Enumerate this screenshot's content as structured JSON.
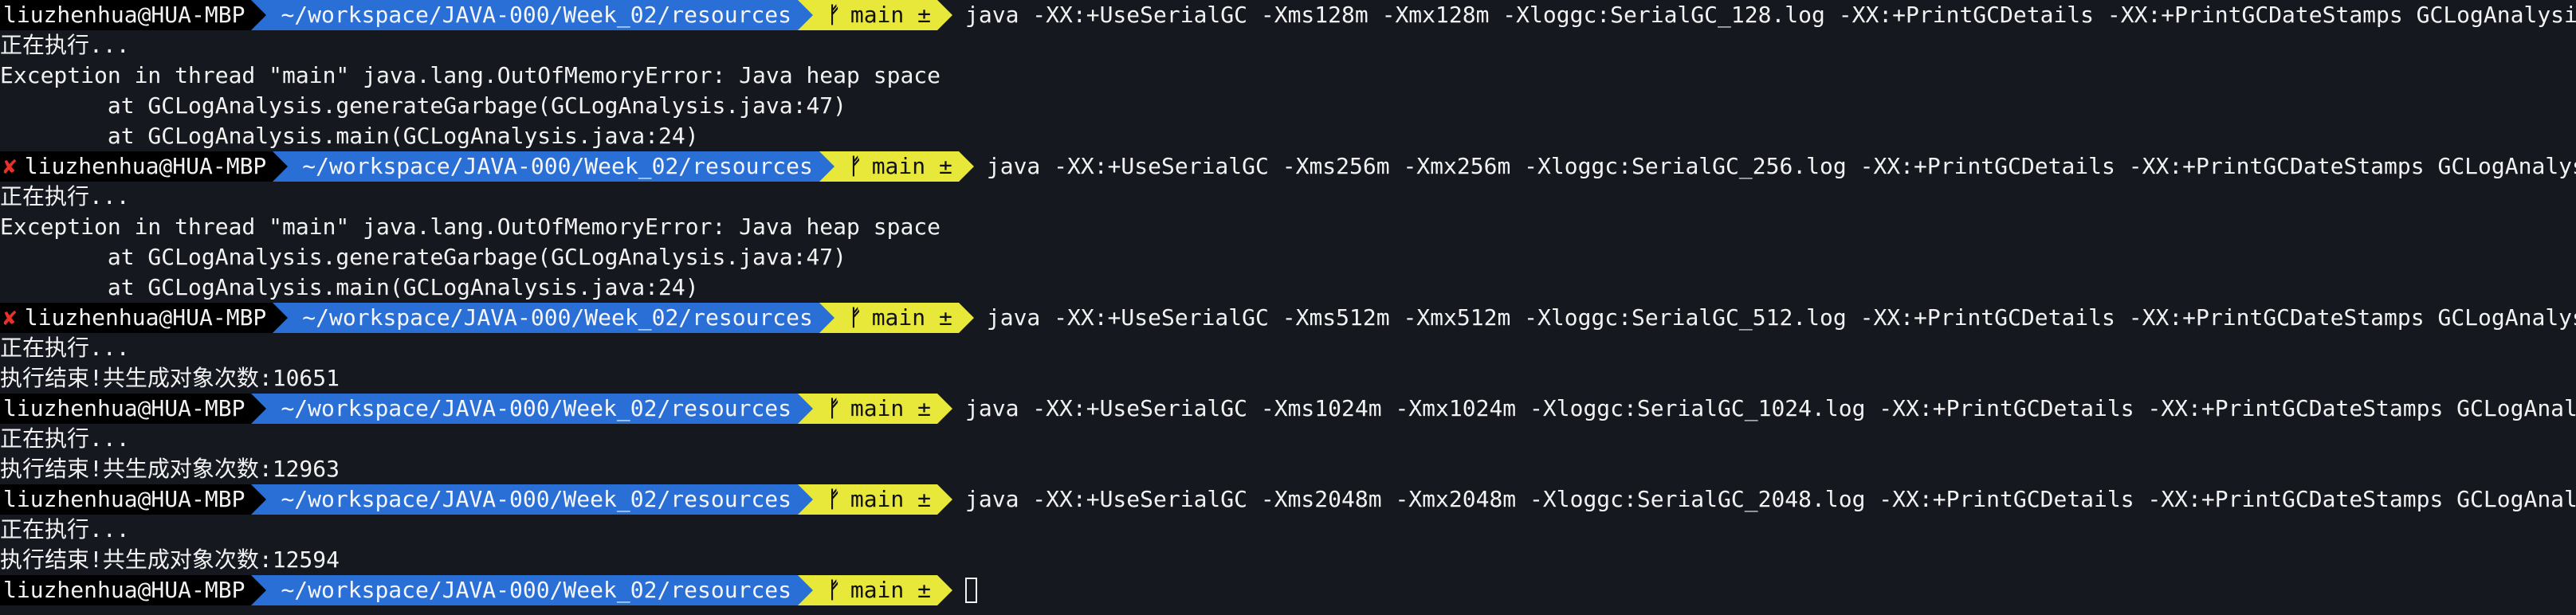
{
  "prompt": {
    "user_host": "liuzhenhua@HUA-MBP",
    "directory": "~/workspace/JAVA-000/Week_02/resources",
    "branch": "main ±",
    "error_mark": "✘",
    "branch_icon": "branch-icon"
  },
  "colors": {
    "background": "#15181e",
    "user_segment": "#000000",
    "dir_segment": "#2a6fd6",
    "git_segment": "#e8e83a",
    "error_mark": "#e8302b",
    "text": "#f2f2f2"
  },
  "commands": [
    "java -XX:+UseSerialGC -Xms128m -Xmx128m -Xloggc:SerialGC_128.log -XX:+PrintGCDetails -XX:+PrintGCDateStamps GCLogAnalysis",
    "java -XX:+UseSerialGC -Xms256m -Xmx256m -Xloggc:SerialGC_256.log -XX:+PrintGCDetails -XX:+PrintGCDateStamps GCLogAnalysis",
    "java -XX:+UseSerialGC -Xms512m -Xmx512m -Xloggc:SerialGC_512.log -XX:+PrintGCDetails -XX:+PrintGCDateStamps GCLogAnalysis",
    "java -XX:+UseSerialGC -Xms1024m -Xmx1024m -Xloggc:SerialGC_1024.log -XX:+PrintGCDetails -XX:+PrintGCDateStamps GCLogAnalysis",
    "java -XX:+UseSerialGC -Xms2048m -Xmx2048m -Xloggc:SerialGC_2048.log -XX:+PrintGCDetails -XX:+PrintGCDateStamps GCLogAnalysis"
  ],
  "outputs": {
    "run128": [
      "正在执行...",
      "Exception in thread \"main\" java.lang.OutOfMemoryError: Java heap space",
      "        at GCLogAnalysis.generateGarbage(GCLogAnalysis.java:47)",
      "        at GCLogAnalysis.main(GCLogAnalysis.java:24)"
    ],
    "run256": [
      "正在执行...",
      "Exception in thread \"main\" java.lang.OutOfMemoryError: Java heap space",
      "        at GCLogAnalysis.generateGarbage(GCLogAnalysis.java:47)",
      "        at GCLogAnalysis.main(GCLogAnalysis.java:24)"
    ],
    "run512": [
      "正在执行...",
      "执行结束!共生成对象次数:10651"
    ],
    "run1024": [
      "正在执行...",
      "执行结束!共生成对象次数:12963"
    ],
    "run2048": [
      "正在执行...",
      "执行结束!共生成对象次数:12594"
    ]
  }
}
